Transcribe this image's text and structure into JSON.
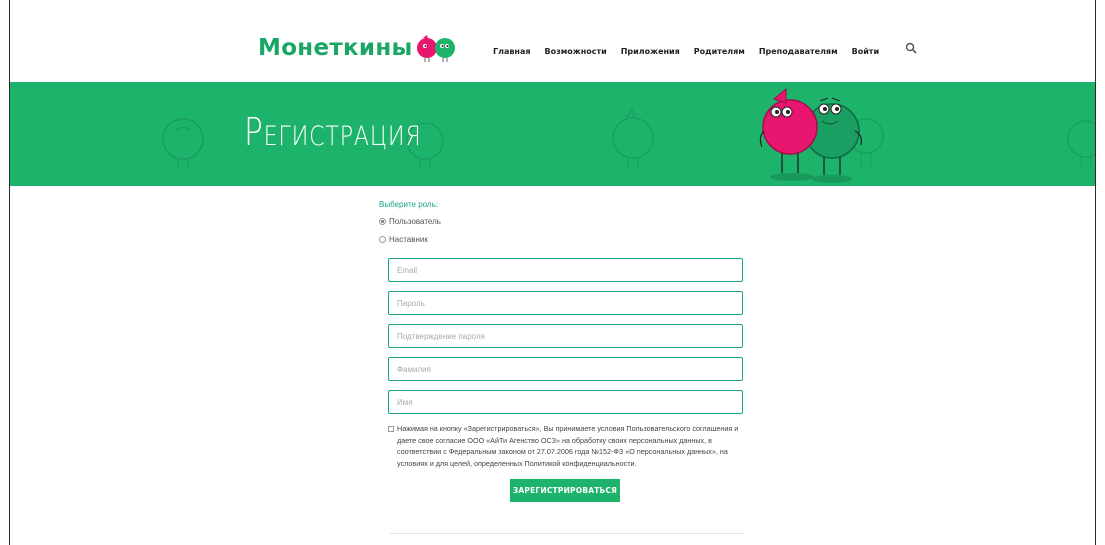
{
  "brand": {
    "name": "Монеткины",
    "colors": {
      "primary": "#1eb36b",
      "pink": "#e8166f",
      "teal": "#1aa389"
    }
  },
  "nav": {
    "items": [
      "Главная",
      "Возможности",
      "Приложения",
      "Родителям",
      "Преподавателям",
      "Войти"
    ],
    "search_icon": "search-icon"
  },
  "hero": {
    "title": "Регистрация"
  },
  "form": {
    "role_label": "Выберите роль:",
    "roles": [
      {
        "label": "Пользователь",
        "selected": true
      },
      {
        "label": "Наставник",
        "selected": false
      }
    ],
    "fields": [
      {
        "placeholder": "Email",
        "value": ""
      },
      {
        "placeholder": "Пароль",
        "value": ""
      },
      {
        "placeholder": "Подтверждение пароля",
        "value": ""
      },
      {
        "placeholder": "Фамилия",
        "value": ""
      },
      {
        "placeholder": "Имя",
        "value": ""
      }
    ],
    "consent_lines": [
      "Нажимая на кнопку «Зарегистрироваться», Вы принимаете условия Пользовательского соглашения и",
      "даете свое согласие ООО «АйТи Агенство ОСЗ» на обработку своих персональных данных, в",
      "соответствии с Федеральным законом от 27.07.2006 года №152-ФЗ «О персональных данных», на",
      "условиях и для целей, определенных Политикой конфиденциальности."
    ],
    "submit_label": "ЗАРЕГИСТРИРОВАТЬСЯ"
  }
}
